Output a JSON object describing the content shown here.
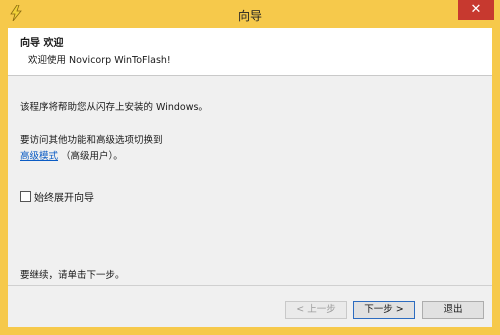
{
  "window": {
    "title": "向导",
    "close_glyph": "✕"
  },
  "header": {
    "title": "向导 欢迎",
    "subtitle": "欢迎使用 Novicorp WinToFlash!"
  },
  "body": {
    "intro": "该程序将帮助您从闪存上安装的 Windows。",
    "advanced_line1": "要访问其他功能和高级选项切换到",
    "advanced_link": "高级模式",
    "advanced_suffix": "（高级用户）。",
    "checkbox_label": "始终展开向导",
    "continue_text": "要继续，请单击下一步。"
  },
  "buttons": {
    "back": "< 上一步",
    "next": "下一步 >",
    "exit": "退出"
  },
  "colors": {
    "frame": "#F6C94B",
    "close": "#C7392F",
    "link": "#0A5BC4"
  }
}
